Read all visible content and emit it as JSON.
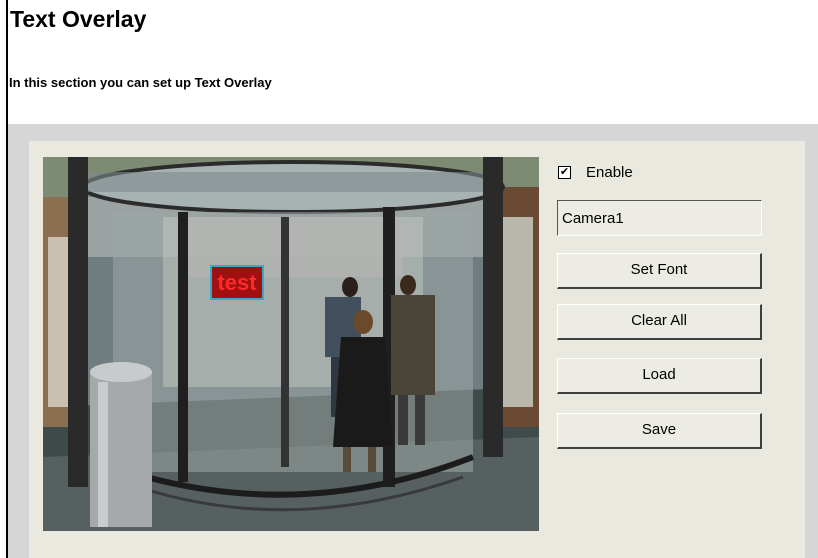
{
  "header": {
    "title": "Text Overlay",
    "subtitle": "In this section you can set up Text Overlay"
  },
  "preview": {
    "overlay_text": "test",
    "overlay_border_color": "#3aa8c8",
    "overlay_text_color": "#ff2a2a"
  },
  "controls": {
    "enable_label": "Enable",
    "enable_checked": true,
    "overlay_text_value": "Camera1",
    "set_font_label": "Set Font",
    "clear_all_label": "Clear All",
    "load_label": "Load",
    "save_label": "Save"
  },
  "colors": {
    "panel_background": "#e9e9df",
    "outer_background": "#d6d6d6"
  }
}
